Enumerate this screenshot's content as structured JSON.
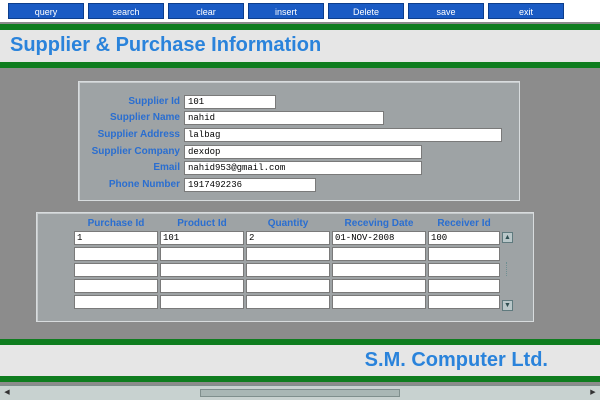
{
  "toolbar": {
    "buttons": [
      "query",
      "search",
      "clear",
      "insert",
      "Delete",
      "save",
      "exit"
    ]
  },
  "header": {
    "title": "Supplier & Purchase Information"
  },
  "supplier": {
    "fields": [
      {
        "label": "Supplier Id",
        "value": "101"
      },
      {
        "label": "Supplier Name",
        "value": "nahid"
      },
      {
        "label": "Supplier Address",
        "value": "lalbag"
      },
      {
        "label": "Supplier Company",
        "value": "dexdop"
      },
      {
        "label": "Email",
        "value": "nahid953@gmail.com"
      },
      {
        "label": "Phone Number",
        "value": "1917492236"
      }
    ]
  },
  "purchase": {
    "columns": [
      "Purchase Id",
      "Product Id",
      "Quantity",
      "Receving Date",
      "Receiver Id"
    ],
    "rows": [
      [
        "1",
        "101",
        "2",
        "01-NOV-2008",
        "100"
      ],
      [
        "",
        "",
        "",
        "",
        ""
      ],
      [
        "",
        "",
        "",
        "",
        ""
      ],
      [
        "",
        "",
        "",
        "",
        ""
      ],
      [
        "",
        "",
        "",
        "",
        ""
      ]
    ],
    "scroll_up_icon": "up-arrow",
    "scroll_down_icon": "down-arrow"
  },
  "footer": {
    "company": "S.M. Computer Ltd."
  },
  "colors": {
    "accent": "#2a83db",
    "green_bar": "#0f7d1f",
    "button": "#1a5bc4"
  }
}
